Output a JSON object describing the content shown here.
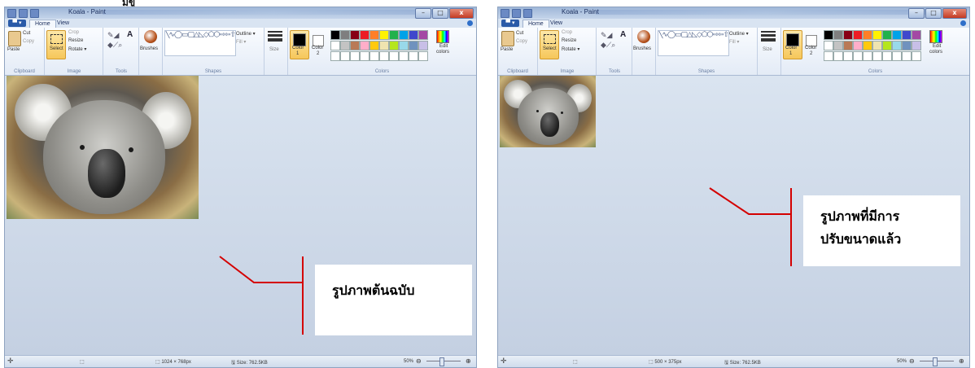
{
  "top_glyph": "มีขู",
  "app": {
    "title": "Koala - Paint",
    "file_tab": "▀ ▾",
    "tabs": [
      "Home",
      "View"
    ],
    "window_buttons": [
      "–",
      "□",
      "x"
    ],
    "ribbon": {
      "clipboard": {
        "paste": "Paste",
        "cut": "Cut",
        "copy": "Copy",
        "label": "Clipboard"
      },
      "image": {
        "select": "Select",
        "crop": "Crop",
        "resize": "Resize",
        "rotate": "Rotate ▾",
        "label": "Image"
      },
      "tools": {
        "label": "Tools",
        "text_glyph": "A"
      },
      "brushes": "Brushes",
      "shapes": {
        "label": "Shapes",
        "outline": "Outline ▾",
        "fill": "Fill ▾",
        "glyphs": "╲∿◯▭▢△◺◇⬠⬡⇨⇦⇧⇩✧✦☆✡▭◯▭▿"
      },
      "size": "Size",
      "color1": {
        "line1": "Color",
        "line2": "1"
      },
      "color2": {
        "line1": "Color",
        "line2": "2"
      },
      "colors_label": "Colors",
      "edit_colors": {
        "line1": "Edit",
        "line2": "colors"
      },
      "palette": [
        "#000000",
        "#7f7f7f",
        "#880015",
        "#ed1c24",
        "#ff7f27",
        "#fff200",
        "#22b14c",
        "#00a2e8",
        "#3f48cc",
        "#a349a4",
        "#ffffff",
        "#c3c3c3",
        "#b97a57",
        "#ffaec9",
        "#ffc90e",
        "#efe4b0",
        "#b5e61d",
        "#99d9ea",
        "#7092be",
        "#c8bfe7",
        "#ffffff",
        "#ffffff",
        "#ffffff",
        "#ffffff",
        "#ffffff",
        "#ffffff",
        "#ffffff",
        "#ffffff",
        "#ffffff",
        "#ffffff"
      ]
    }
  },
  "left_panel": {
    "image_size": "1024 × 768px",
    "file_size": "Size: 762.5KB",
    "zoom": "50%",
    "annotation": "รูปภาพต้นฉบับ"
  },
  "right_panel": {
    "image_size": "500 × 375px",
    "file_size": "Size: 762.5KB",
    "zoom": "50%",
    "annotation_line1": "รูปภาพที่มีการ",
    "annotation_line2": "ปรับขนาดแล้ว"
  }
}
